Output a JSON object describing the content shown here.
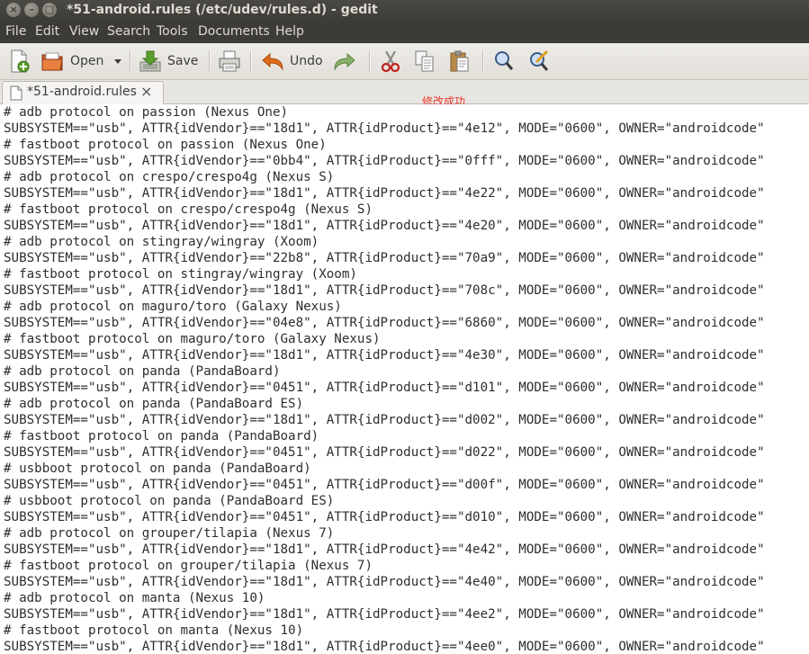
{
  "window": {
    "title": "*51-android.rules (/etc/udev/rules.d) - gedit",
    "close_glyph": "×",
    "minimize_glyph": "–",
    "maximize_glyph": "□"
  },
  "menu": [
    "File",
    "Edit",
    "View",
    "Search",
    "Tools",
    "Documents",
    "Help"
  ],
  "toolbar": {
    "open_label": "Open",
    "save_label": "Save",
    "undo_label": "Undo"
  },
  "tab": {
    "label": "*51-android.rules",
    "close_glyph": "×"
  },
  "annotation": "修改成功",
  "editor": {
    "lines": [
      "# adb protocol on passion (Nexus One)",
      "SUBSYSTEM==\"usb\", ATTR{idVendor}==\"18d1\", ATTR{idProduct}==\"4e12\", MODE=\"0600\", OWNER=\"androidcode\"",
      "# fastboot protocol on passion (Nexus One)",
      "SUBSYSTEM==\"usb\", ATTR{idVendor}==\"0bb4\", ATTR{idProduct}==\"0fff\", MODE=\"0600\", OWNER=\"androidcode\"",
      "# adb protocol on crespo/crespo4g (Nexus S)",
      "SUBSYSTEM==\"usb\", ATTR{idVendor}==\"18d1\", ATTR{idProduct}==\"4e22\", MODE=\"0600\", OWNER=\"androidcode\"",
      "# fastboot protocol on crespo/crespo4g (Nexus S)",
      "SUBSYSTEM==\"usb\", ATTR{idVendor}==\"18d1\", ATTR{idProduct}==\"4e20\", MODE=\"0600\", OWNER=\"androidcode\"",
      "# adb protocol on stingray/wingray (Xoom)",
      "SUBSYSTEM==\"usb\", ATTR{idVendor}==\"22b8\", ATTR{idProduct}==\"70a9\", MODE=\"0600\", OWNER=\"androidcode\"",
      "# fastboot protocol on stingray/wingray (Xoom)",
      "SUBSYSTEM==\"usb\", ATTR{idVendor}==\"18d1\", ATTR{idProduct}==\"708c\", MODE=\"0600\", OWNER=\"androidcode\"",
      "# adb protocol on maguro/toro (Galaxy Nexus)",
      "SUBSYSTEM==\"usb\", ATTR{idVendor}==\"04e8\", ATTR{idProduct}==\"6860\", MODE=\"0600\", OWNER=\"androidcode\"",
      "# fastboot protocol on maguro/toro (Galaxy Nexus)",
      "SUBSYSTEM==\"usb\", ATTR{idVendor}==\"18d1\", ATTR{idProduct}==\"4e30\", MODE=\"0600\", OWNER=\"androidcode\"",
      "# adb protocol on panda (PandaBoard)",
      "SUBSYSTEM==\"usb\", ATTR{idVendor}==\"0451\", ATTR{idProduct}==\"d101\", MODE=\"0600\", OWNER=\"androidcode\"",
      "# adb protocol on panda (PandaBoard ES)",
      "SUBSYSTEM==\"usb\", ATTR{idVendor}==\"18d1\", ATTR{idProduct}==\"d002\", MODE=\"0600\", OWNER=\"androidcode\"",
      "# fastboot protocol on panda (PandaBoard)",
      "SUBSYSTEM==\"usb\", ATTR{idVendor}==\"0451\", ATTR{idProduct}==\"d022\", MODE=\"0600\", OWNER=\"androidcode\"",
      "# usbboot protocol on panda (PandaBoard)",
      "SUBSYSTEM==\"usb\", ATTR{idVendor}==\"0451\", ATTR{idProduct}==\"d00f\", MODE=\"0600\", OWNER=\"androidcode\"",
      "# usbboot protocol on panda (PandaBoard ES)",
      "SUBSYSTEM==\"usb\", ATTR{idVendor}==\"0451\", ATTR{idProduct}==\"d010\", MODE=\"0600\", OWNER=\"androidcode\"",
      "# adb protocol on grouper/tilapia (Nexus 7)",
      "SUBSYSTEM==\"usb\", ATTR{idVendor}==\"18d1\", ATTR{idProduct}==\"4e42\", MODE=\"0600\", OWNER=\"androidcode\"",
      "# fastboot protocol on grouper/tilapia (Nexus 7)",
      "SUBSYSTEM==\"usb\", ATTR{idVendor}==\"18d1\", ATTR{idProduct}==\"4e40\", MODE=\"0600\", OWNER=\"androidcode\"",
      "# adb protocol on manta (Nexus 10)",
      "SUBSYSTEM==\"usb\", ATTR{idVendor}==\"18d1\", ATTR{idProduct}==\"4ee2\", MODE=\"0600\", OWNER=\"androidcode\"",
      "# fastboot protocol on manta (Nexus 10)",
      "SUBSYSTEM==\"usb\", ATTR{idVendor}==\"18d1\", ATTR{idProduct}==\"4ee0\", MODE=\"0600\", OWNER=\"androidcode\""
    ]
  }
}
